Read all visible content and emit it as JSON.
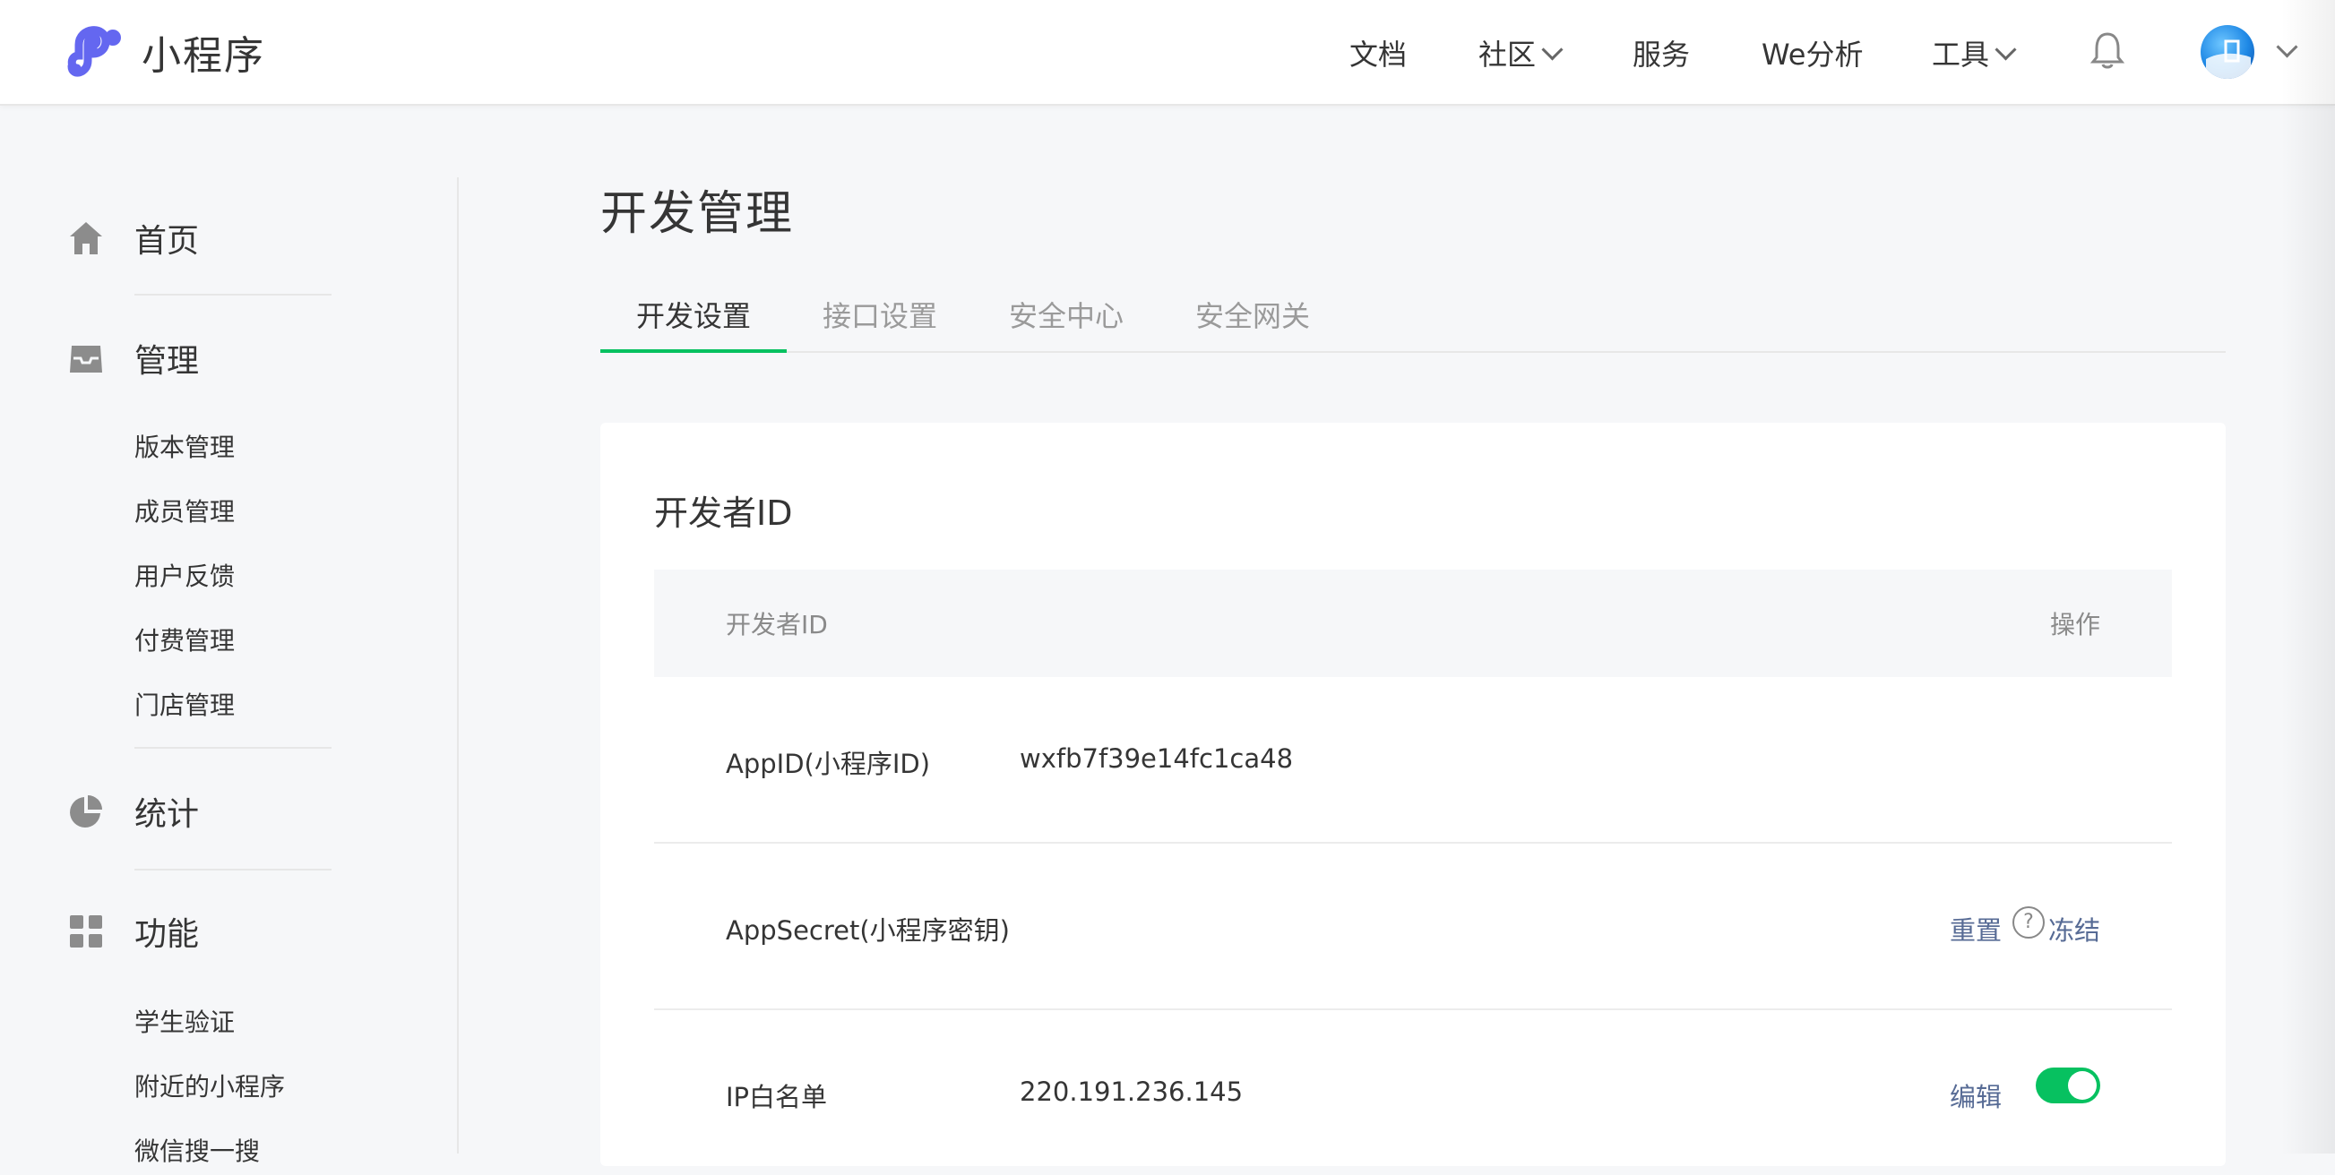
{
  "header": {
    "brand": "小程序",
    "nav": [
      {
        "label": "文档"
      },
      {
        "label": "社区"
      },
      {
        "label": "服务"
      },
      {
        "label": "We分析"
      },
      {
        "label": "工具"
      }
    ],
    "icons": {
      "logo": "miniprogram-logo",
      "bell": "bell-icon",
      "avatar": "user-avatar"
    }
  },
  "sidebar": {
    "home": "首页",
    "manage": "管理",
    "manage_items": [
      "版本管理",
      "成员管理",
      "用户反馈",
      "付费管理",
      "门店管理"
    ],
    "stats": "统计",
    "features": "功能",
    "feature_items": [
      "学生验证",
      "附近的小程序",
      "微信搜一搜"
    ]
  },
  "main": {
    "title": "开发管理",
    "tabs": [
      "开发设置",
      "接口设置",
      "安全中心",
      "安全网关"
    ],
    "active_tab": 0,
    "card": {
      "title": "开发者ID",
      "columns": {
        "name": "开发者ID",
        "ops": "操作"
      },
      "rows": [
        {
          "label": "AppID(小程序ID)",
          "value": "wxfb7f39e14fc1ca48"
        },
        {
          "label": "AppSecret(小程序密钥)",
          "value": "",
          "op_reset": "重置",
          "op_freeze": "冻结"
        },
        {
          "label": "IP白名单",
          "value": "220.191.236.145",
          "op_edit": "编辑",
          "toggle_on": true
        }
      ]
    }
  },
  "colors": {
    "accent": "#07c160",
    "link": "#576b95",
    "logo": "#6467f0"
  }
}
